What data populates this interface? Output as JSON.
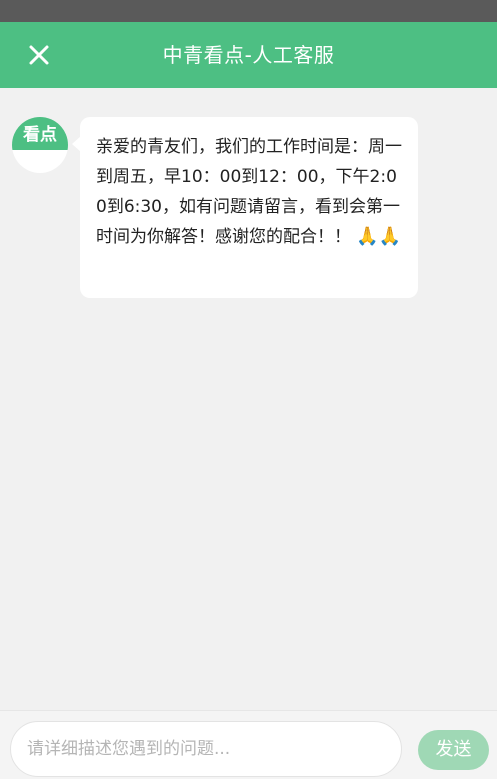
{
  "header": {
    "title": "中青看点-人工客服",
    "close_icon": "close-icon"
  },
  "chat": {
    "agent": {
      "avatar_text": "看点"
    },
    "messages": [
      {
        "text": "亲爱的青友们，我们的工作时间是：周一到周五，早10：00到12：00，下午2:00到6:30，如有问题请留言，看到会第一时间为你解答！感谢您的配合！！",
        "emoji": "🙏🙏"
      }
    ]
  },
  "footer": {
    "input_placeholder": "请详细描述您遇到的问题...",
    "send_label": "发送"
  },
  "colors": {
    "brand": "#4dbf83",
    "send_disabled": "#9fd8b5",
    "background": "#f1f1f1"
  }
}
